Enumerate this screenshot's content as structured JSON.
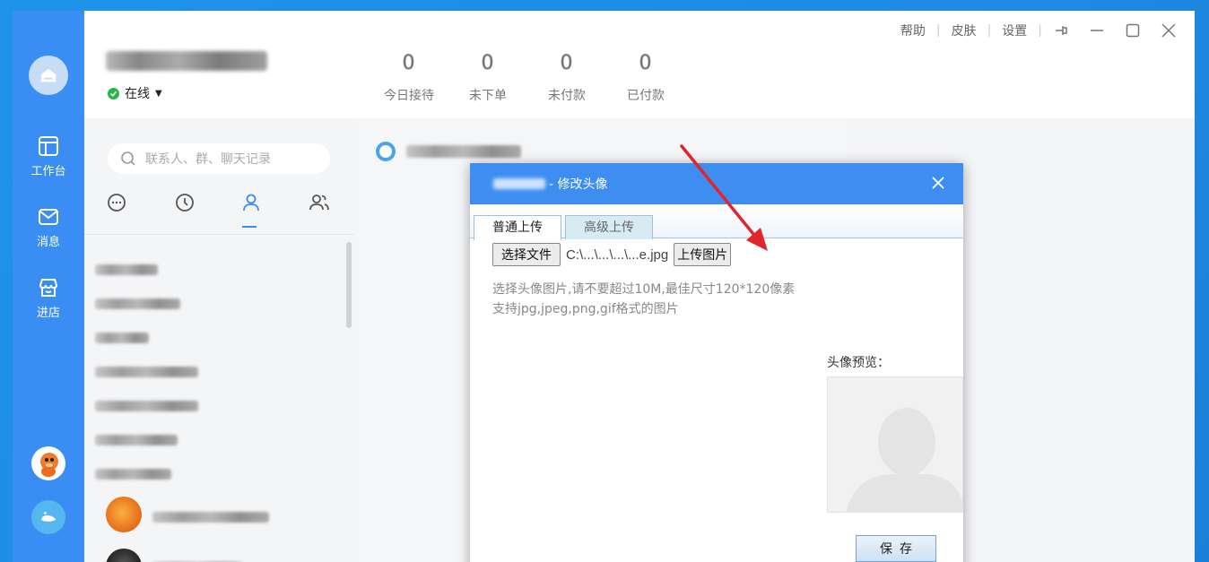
{
  "header": {
    "status": "在线",
    "stats": [
      {
        "value": "0",
        "label": "今日接待"
      },
      {
        "value": "0",
        "label": "未下单"
      },
      {
        "value": "0",
        "label": "未付款"
      },
      {
        "value": "0",
        "label": "已付款"
      }
    ],
    "menu": {
      "help": "帮助",
      "skin": "皮肤",
      "settings": "设置"
    }
  },
  "rail": {
    "workbench": "工作台",
    "messages": "消息",
    "store": "进店"
  },
  "panel": {
    "search_placeholder": "联系人、群、聊天记录"
  },
  "dialog": {
    "title": "- 修改头像",
    "tabs": {
      "normal": "普通上传",
      "advanced": "高级上传"
    },
    "choose_file": "选择文件",
    "file_name": "C:\\...\\...\\...\\...e.jpg",
    "upload": "上传图片",
    "hint_line1": "选择头像图片,请不要超过10M,最佳尺寸120*120像素",
    "hint_line2": "支持jpg,jpeg,png,gif格式的图片",
    "preview_label": "头像预览：",
    "save": "保存"
  },
  "colors": {
    "accent": "#3e8ef1",
    "rail": "#3a8df2",
    "online": "#2bb34a",
    "arrow": "#e0252b"
  }
}
